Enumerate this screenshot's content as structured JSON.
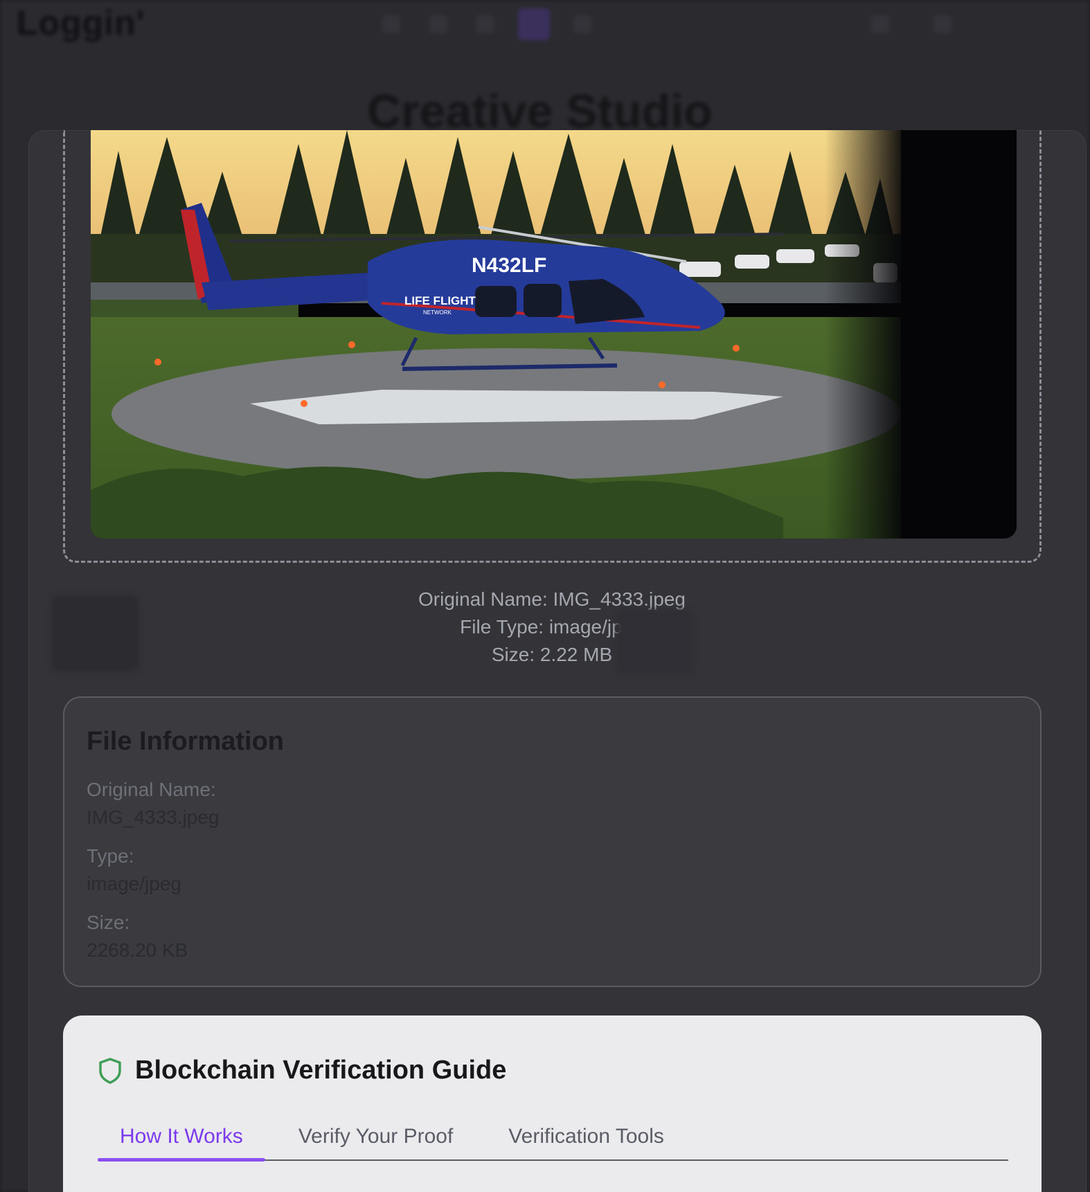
{
  "background": {
    "logo": "Loggin'",
    "hero_title": "Creative Studio"
  },
  "preview": {
    "registration": "N432LF",
    "brand": "LIFE FLIGHT",
    "brand_sub": "NETWORK"
  },
  "file_summary": {
    "original_name": "Original Name: IMG_4333.jpeg",
    "file_type": "File Type: image/jpeg",
    "size": "Size: 2.22 MB"
  },
  "file_info": {
    "title": "File Information",
    "fields": [
      {
        "label": "Original Name:",
        "value": "IMG_4333.jpeg"
      },
      {
        "label": "Type:",
        "value": "image/jpeg"
      },
      {
        "label": "Size:",
        "value": "2268.20 KB"
      }
    ]
  },
  "guide": {
    "title": "Blockchain Verification Guide",
    "icon": "shield-icon",
    "tabs": [
      {
        "label": "How It Works",
        "active": true
      },
      {
        "label": "Verify Your Proof",
        "active": false
      },
      {
        "label": "Verification Tools",
        "active": false
      }
    ]
  },
  "colors": {
    "accent": "#8b4ff0",
    "shield": "#3f9e57",
    "overlay": "#333338"
  }
}
